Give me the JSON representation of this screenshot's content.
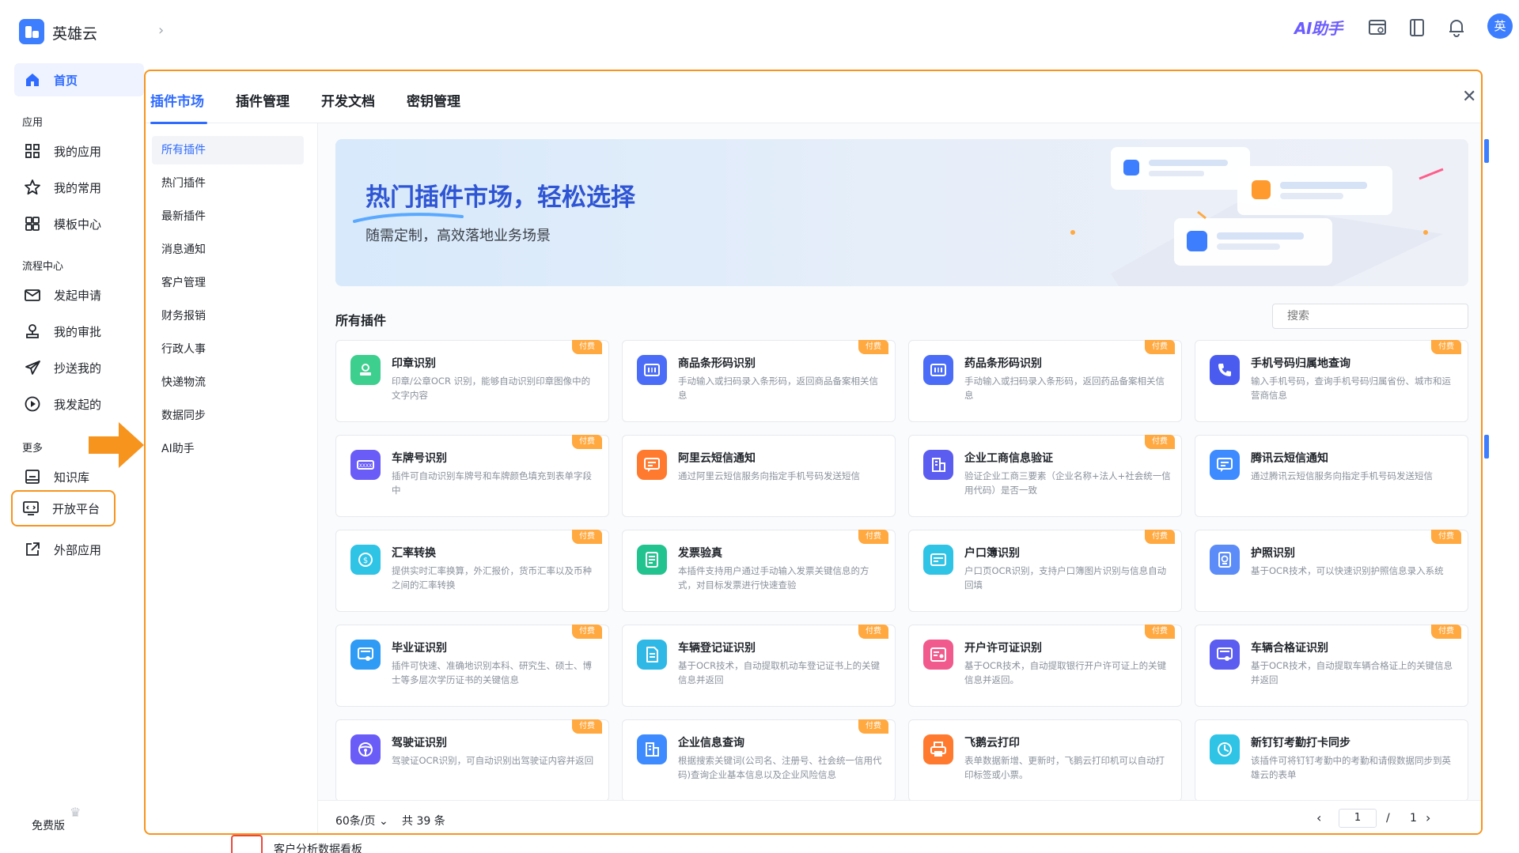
{
  "app": {
    "name": "英雄云",
    "ai_label": "AI助手",
    "avatar": "英"
  },
  "sidebar": {
    "home": "首页",
    "sections": {
      "apps": "应用",
      "flow": "流程中心",
      "more": "更多"
    },
    "items": {
      "my_apps": "我的应用",
      "my_favorites": "我的常用",
      "templates": "模板中心",
      "submit": "发起申请",
      "my_approvals": "我的审批",
      "cc_me": "抄送我的",
      "started": "我发起的",
      "knowledge": "知识库",
      "open_platform": "开放平台",
      "external": "外部应用"
    },
    "free": "免费版"
  },
  "background": {
    "bottom_text": "客户分析数据看板"
  },
  "dialog": {
    "tabs": [
      "插件市场",
      "插件管理",
      "开发文档",
      "密钥管理"
    ],
    "categories": [
      "所有插件",
      "热门插件",
      "最新插件",
      "消息通知",
      "客户管理",
      "财务报销",
      "行政人事",
      "快递物流",
      "数据同步",
      "AI助手"
    ],
    "banner": {
      "title": "热门插件市场，轻松选择",
      "subtitle": "随需定制，高效落地业务场景"
    },
    "section_title": "所有插件",
    "search_placeholder": "搜索",
    "paid_badge": "付费",
    "cards": [
      {
        "title": "印章识别",
        "desc": "印章/公章OCR 识别，能够自动识别印章图像中的文字内容",
        "color": "#3ccf8e",
        "icon": "stamp-icon",
        "paid": true
      },
      {
        "title": "商品条形码识别",
        "desc": "手动输入或扫码录入条形码，返回商品备案相关信息",
        "color": "#4a6cf7",
        "icon": "barcode-icon",
        "paid": true
      },
      {
        "title": "药品条形码识别",
        "desc": "手动输入或扫码录入条形码，返回药品备案相关信息",
        "color": "#4a6cf7",
        "icon": "barcode-icon",
        "paid": true
      },
      {
        "title": "手机号码归属地查询",
        "desc": "输入手机号码，查询手机号码归属省份、城市和运营商信息",
        "color": "#4a5cf0",
        "icon": "phone-icon",
        "paid": true
      },
      {
        "title": "车牌号识别",
        "desc": "插件可自动识别车牌号和车牌颜色填充到表单字段中",
        "color": "#6a5cf7",
        "icon": "license-plate-icon",
        "paid": true
      },
      {
        "title": "阿里云短信通知",
        "desc": "通过阿里云短信服务向指定手机号码发送短信",
        "color": "#ff7a2f",
        "icon": "sms-icon",
        "paid": false
      },
      {
        "title": "企业工商信息验证",
        "desc": "验证企业工商三要素（企业名称+法人+社会统一信用代码）是否一致",
        "color": "#5b5cf0",
        "icon": "building-icon",
        "paid": true
      },
      {
        "title": "腾讯云短信通知",
        "desc": "通过腾讯云短信服务向指定手机号码发送短信",
        "color": "#3d8bff",
        "icon": "sms-icon",
        "paid": false
      },
      {
        "title": "汇率转换",
        "desc": "提供实时汇率换算，外汇报价，货币汇率以及币种之间的汇率转换",
        "color": "#2fc3e6",
        "icon": "currency-icon",
        "paid": true
      },
      {
        "title": "发票验真",
        "desc": "本插件支持用户通过手动输入发票关键信息的方式，对目标发票进行快速查验",
        "color": "#22c38e",
        "icon": "invoice-icon",
        "paid": true
      },
      {
        "title": "户口簿识别",
        "desc": "户口页OCR识别，支持户口簿图片识别与信息自动回填",
        "color": "#2fc3e6",
        "icon": "id-card-icon",
        "paid": true
      },
      {
        "title": "护照识别",
        "desc": "基于OCR技术，可以快速识别护照信息录入系统",
        "color": "#5b8cf7",
        "icon": "passport-icon",
        "paid": true
      },
      {
        "title": "毕业证识别",
        "desc": "插件可快速、准确地识别本科、研究生、硕士、博士等多层次学历证书的关键信息",
        "color": "#2f9bf5",
        "icon": "certificate-icon",
        "paid": true
      },
      {
        "title": "车辆登记证识别",
        "desc": "基于OCR技术，自动提取机动车登记证书上的关键信息并返回",
        "color": "#2fb8e6",
        "icon": "document-icon",
        "paid": true
      },
      {
        "title": "开户许可证识别",
        "desc": "基于OCR技术，自动提取银行开户许可证上的关键信息并返回。",
        "color": "#f05a8c",
        "icon": "license-icon",
        "paid": true
      },
      {
        "title": "车辆合格证识别",
        "desc": "基于OCR技术，自动提取车辆合格证上的关键信息并返回",
        "color": "#5b5cf0",
        "icon": "certificate-icon",
        "paid": true
      },
      {
        "title": "驾驶证识别",
        "desc": "驾驶证OCR识别，可自动识别出驾驶证内容并返回",
        "color": "#6a5cf7",
        "icon": "steering-wheel-icon",
        "paid": true
      },
      {
        "title": "企业信息查询",
        "desc": "根据搜索关键词(公司名、注册号、社会统一信用代码)查询企业基本信息以及企业风险信息",
        "color": "#3d8bff",
        "icon": "building-icon",
        "paid": true
      },
      {
        "title": "飞鹅云打印",
        "desc": "表单数据新增、更新时，飞鹅云打印机可以自动打印标签或小票。",
        "color": "#ff7a2f",
        "icon": "printer-icon",
        "paid": false
      },
      {
        "title": "新钉钉考勤打卡同步",
        "desc": "该插件可将钉钉考勤中的考勤和请假数据同步到英雄云的表单",
        "color": "#2fc3e6",
        "icon": "clock-icon",
        "paid": false
      }
    ],
    "footer": {
      "page_size": "60条/页",
      "total": "共 39 条",
      "current_page": "1",
      "separator": "/",
      "total_pages": "1"
    }
  }
}
